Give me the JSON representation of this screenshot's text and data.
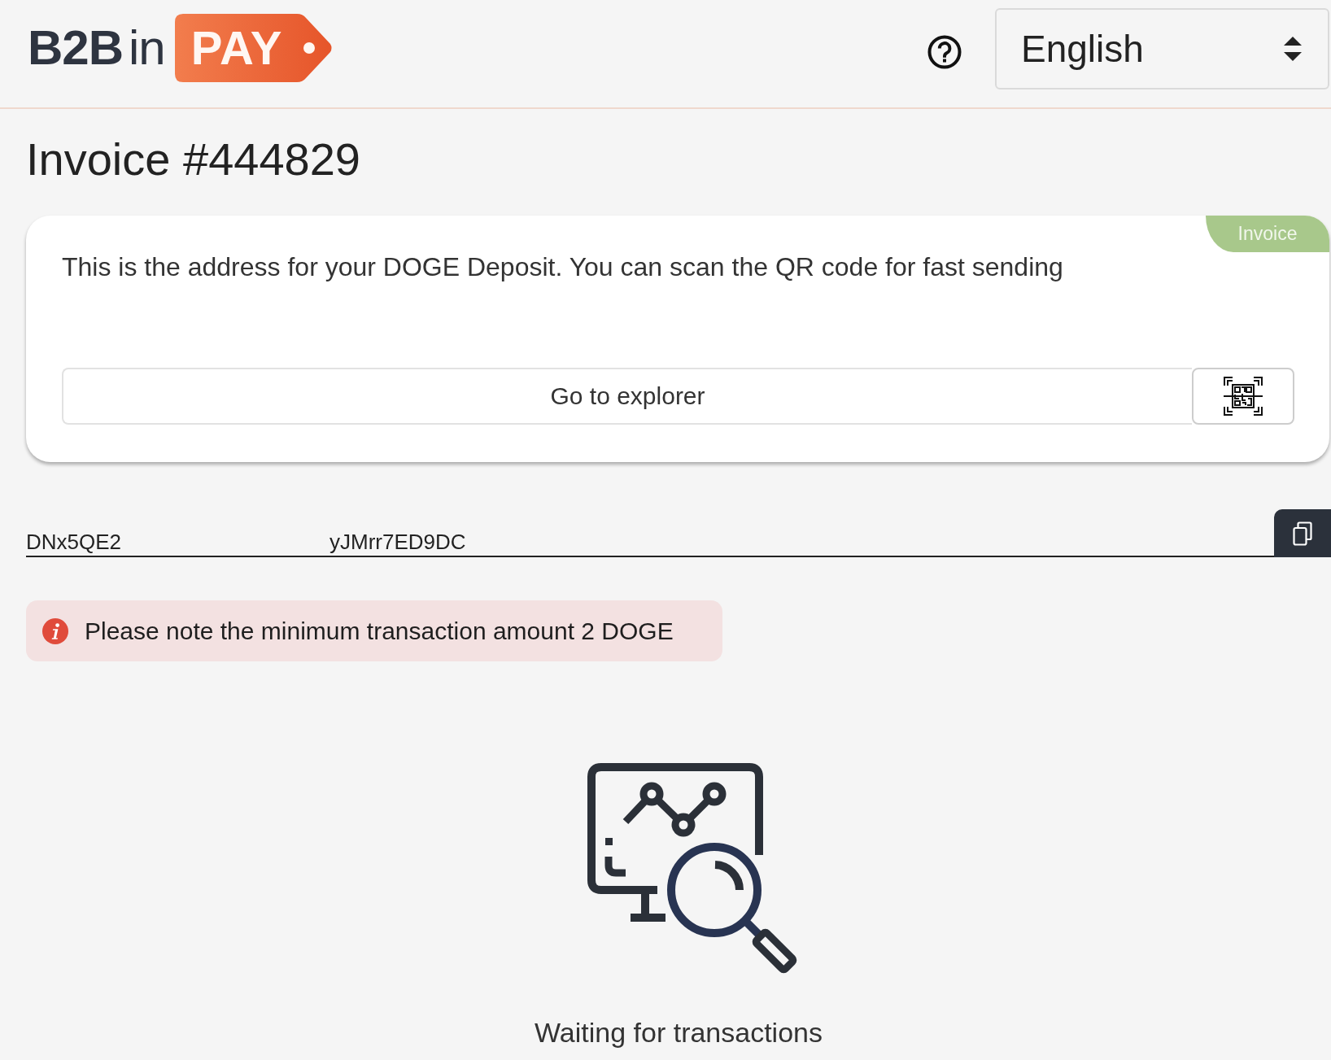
{
  "header": {
    "logo": {
      "wordmark": "**B2B**in",
      "tag": "PAY"
    },
    "language_select": {
      "value": "English"
    }
  },
  "title": "Invoice #444829",
  "deposit_card": {
    "badge": "Invoice",
    "message": "This is the address for your DOGE Deposit. You can scan the QR code for fast sending",
    "explorer_button": "Go to explorer"
  },
  "address": {
    "start": "DNx5QE2",
    "end": "yJMrr7ED9DC"
  },
  "notice": {
    "text": "Please note the minimum transaction amount 2 DOGE"
  },
  "status": {
    "text": "Waiting for transactions"
  }
}
